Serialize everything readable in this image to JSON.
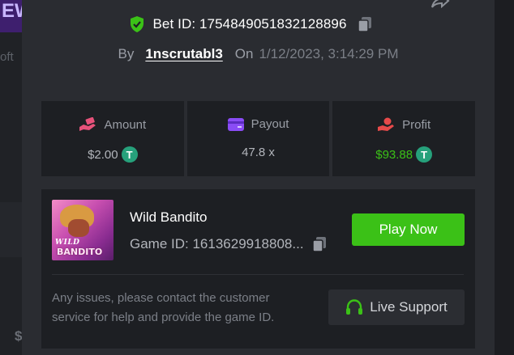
{
  "background": {
    "logo_text": "EW",
    "side_text": "oft",
    "dollar": "$"
  },
  "bet": {
    "label": "Bet ID: 1754849051832128896",
    "by_label": "By",
    "user": "1nscrutabl3",
    "on_label": "On",
    "date": "1/12/2023, 3:14:29 PM"
  },
  "stats": [
    {
      "label": "Amount",
      "value": "$2.00",
      "icon": "money-hand-icon",
      "color": "#e6527a",
      "value_color": "#b2b5bb",
      "coin": true
    },
    {
      "label": "Payout",
      "value": "47.8 x",
      "icon": "card-icon",
      "color": "#8a4cf5",
      "value_color": "#b2b5bb",
      "coin": false
    },
    {
      "label": "Profit",
      "value": "$93.88",
      "icon": "profit-hand-icon",
      "color": "#e84a4a",
      "value_color": "#3bc117",
      "coin": true
    }
  ],
  "coin_symbol": "T",
  "game": {
    "name": "Wild Bandito",
    "id_text": "Game ID: 1613629918808...",
    "thumb_line1": "WILD",
    "thumb_line2": "BANDITO",
    "play_label": "Play Now",
    "help_text": "Any issues, please contact the customer service for help and provide the game ID.",
    "support_label": "Live Support"
  },
  "colors": {
    "accent_green": "#3bc117",
    "tether_green": "#26a17b",
    "modal_bg": "#2a2c31",
    "card_bg": "#1d1f23"
  }
}
